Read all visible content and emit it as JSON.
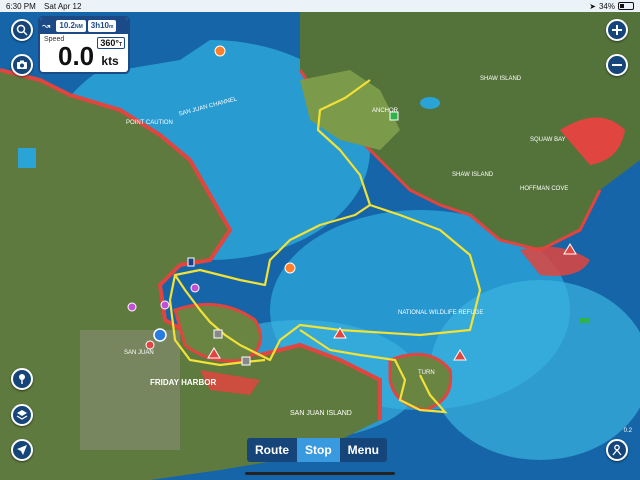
{
  "status_bar": {
    "time": "6:30 PM",
    "date": "Sat Apr 12",
    "battery": "34%"
  },
  "instrument_panel": {
    "distance": "10.2",
    "distance_unit": "NM",
    "duration": "3h10",
    "duration_unit": "m",
    "speed_label": "Speed",
    "speed_value": "0.0",
    "speed_unit": "kts",
    "heading": "360°",
    "heading_suffix": "T"
  },
  "bottom_bar": {
    "route": "Route",
    "stop": "Stop",
    "menu": "Menu"
  },
  "map_labels": {
    "san_juan_channel": "SAN JUAN CHANNEL",
    "shaw_island_1": "SHAW ISLAND",
    "shaw_island_2": "SHAW ISLAND",
    "san_juan_island": "SAN JUAN ISLAND",
    "friday_harbor": "FRIDAY HARBOR",
    "squaw_bay": "SQUAW BAY",
    "hoffman_cove": "HOFFMAN COVE",
    "point_caution": "POINT CAUTION",
    "anchor": "ANCHOR",
    "turn": "TURN",
    "san_juan": "SAN JUAN",
    "national_wildlife": "NATIONAL WILDLIFE REFUGE",
    "scale": "0.2"
  },
  "colors": {
    "deep_water": "#1565a8",
    "shallow_water": "#2fb3df",
    "land": "#5f7a3e",
    "shore_red": "#e0453f",
    "track": "#f2e136",
    "button_blue": "#16457a"
  },
  "icons": {
    "search": "search-icon",
    "camera": "camera-icon",
    "zoom_in": "plus-icon",
    "zoom_out": "minus-icon",
    "pin": "pin-icon",
    "layers": "layers-icon",
    "locate": "location-arrow-icon",
    "user": "user-icon"
  }
}
